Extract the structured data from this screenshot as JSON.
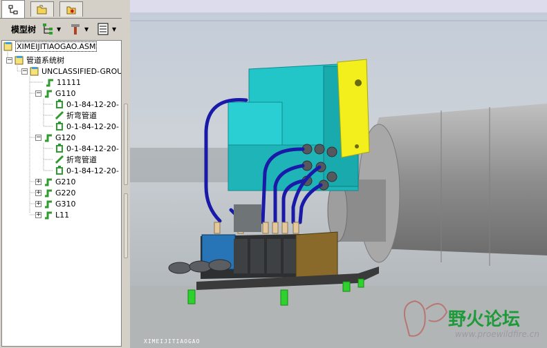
{
  "tabs": [
    {
      "icon": "model-tree-icon"
    },
    {
      "icon": "folder-browser-icon"
    },
    {
      "icon": "favorites-icon"
    }
  ],
  "toolbar": {
    "label": "模型树",
    "buttons": [
      {
        "icon": "tree-display-icon",
        "has_dropdown": true
      },
      {
        "icon": "tools-icon",
        "has_dropdown": true
      },
      {
        "icon": "settings-list-icon",
        "has_dropdown": true
      }
    ]
  },
  "tree": {
    "items": [
      {
        "label": "XIMEIJITIAOGAO.ASM",
        "icon": "assembly-icon",
        "expander": "",
        "selected": true
      },
      {
        "label": "管道系统树",
        "icon": "assembly-icon",
        "expander": "−"
      },
      {
        "label": "UNCLASSIFIED-GROUI",
        "icon": "assembly-icon",
        "expander": "−"
      },
      {
        "label": "11111",
        "icon": "pipeline-icon",
        "expander": ""
      },
      {
        "label": "G110",
        "icon": "pipeline-icon",
        "expander": "−"
      },
      {
        "label": "0-1-84-12-20-",
        "icon": "fitting-icon",
        "expander": ""
      },
      {
        "label": "折弯管道",
        "icon": "pipe-segment-icon",
        "expander": ""
      },
      {
        "label": "0-1-84-12-20-",
        "icon": "fitting-icon",
        "expander": ""
      },
      {
        "label": "G120",
        "icon": "pipeline-icon",
        "expander": "−"
      },
      {
        "label": "0-1-84-12-20-",
        "icon": "fitting-icon",
        "expander": ""
      },
      {
        "label": "折弯管道",
        "icon": "pipe-segment-icon",
        "expander": ""
      },
      {
        "label": "0-1-84-12-20-",
        "icon": "fitting-icon",
        "expander": ""
      },
      {
        "label": "G210",
        "icon": "pipeline-icon",
        "expander": "+"
      },
      {
        "label": "G220",
        "icon": "pipeline-icon",
        "expander": "+"
      },
      {
        "label": "G310",
        "icon": "pipeline-icon",
        "expander": "+"
      },
      {
        "label": "L11",
        "icon": "pipeline-icon",
        "expander": "+"
      }
    ]
  },
  "viewport": {
    "caption": "XIMEIJITIAOGAO",
    "background_color": "#c6cbd1",
    "accent_colors": {
      "manifold": "#22c6c9",
      "yellow_block": "#f2ef1c",
      "pipe": "#1a1aa8",
      "shaft": "#9a9a9a",
      "feet": "#2fd12f"
    }
  },
  "watermark": {
    "text": "野火论坛",
    "url": "www.proewildfire.cn"
  }
}
